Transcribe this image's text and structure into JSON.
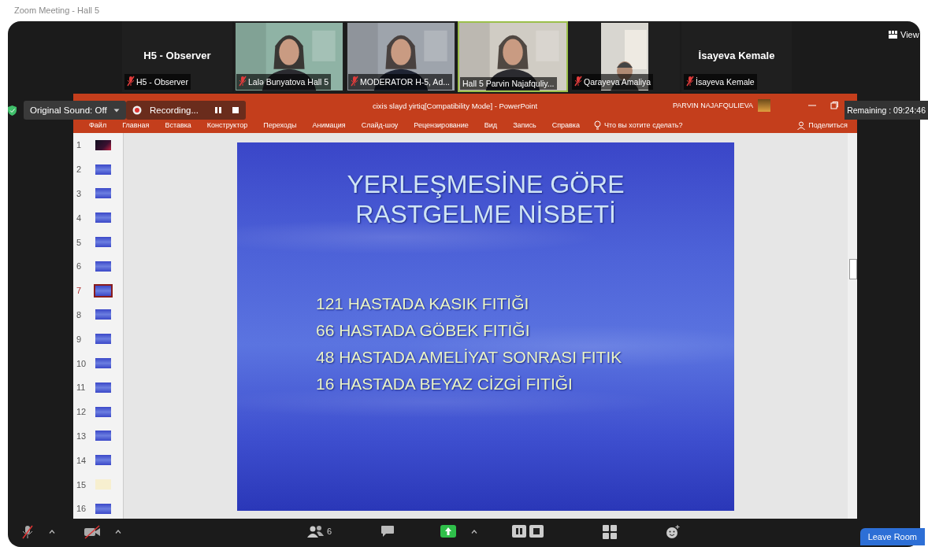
{
  "window": {
    "title": "Zoom Meeting - Hall 5"
  },
  "participants": [
    {
      "kind": "name",
      "name": "H5 - Observer",
      "label": "H5 - Observer",
      "muted": true,
      "speaking": false
    },
    {
      "kind": "video",
      "label": "Lalə Bunyatova Hall 5",
      "muted": true,
      "speaking": false
    },
    {
      "kind": "video",
      "label": "MODERATOR H-5, Ad...",
      "muted": true,
      "speaking": false
    },
    {
      "kind": "video",
      "label": "Hall 5  Parvin Najafquliy...",
      "muted": false,
      "speaking": true
    },
    {
      "kind": "small-video",
      "label": "Qarayeva Amaliya",
      "muted": true,
      "speaking": false
    },
    {
      "kind": "name",
      "name": "İsayeva Kemale",
      "label": "İsayeva Kemale",
      "muted": true,
      "speaking": false
    }
  ],
  "view_button": "View",
  "original_sound": "Original Sound: Off",
  "recording": "Recording...",
  "remaining": "Remaining : 09:24:46",
  "powerpoint": {
    "title": "cixis slayd yirtiq[Compatibility Mode]  -  PowerPoint",
    "user": "PARVIN NAJAFQULIEVA",
    "tabs": [
      "Файл",
      "Главная",
      "Вставка",
      "Конструктор",
      "Переходы",
      "Анимация",
      "Слайд-шоу",
      "Рецензирование",
      "Вид",
      "Запись",
      "Справка"
    ],
    "tell_me": "Что вы хотите сделать?",
    "share": "Поделиться",
    "thumbnails": [
      {
        "number": "1",
        "kind": "dark",
        "selected": false
      },
      {
        "number": "2",
        "kind": "blue",
        "selected": false
      },
      {
        "number": "3",
        "kind": "blue",
        "selected": false
      },
      {
        "number": "4",
        "kind": "blue",
        "selected": false
      },
      {
        "number": "5",
        "kind": "blue",
        "selected": false
      },
      {
        "number": "6",
        "kind": "blue",
        "selected": false
      },
      {
        "number": "7",
        "kind": "blue",
        "selected": true
      },
      {
        "number": "8",
        "kind": "blue",
        "selected": false
      },
      {
        "number": "9",
        "kind": "blue",
        "selected": false
      },
      {
        "number": "10",
        "kind": "blue",
        "selected": false
      },
      {
        "number": "11",
        "kind": "blue",
        "selected": false
      },
      {
        "number": "12",
        "kind": "blue",
        "selected": false
      },
      {
        "number": "13",
        "kind": "blue",
        "selected": false
      },
      {
        "number": "14",
        "kind": "blue",
        "selected": false
      },
      {
        "number": "15",
        "kind": "light",
        "selected": false
      },
      {
        "number": "16",
        "kind": "blue",
        "selected": false
      }
    ],
    "slide": {
      "title": [
        "YERLEŞMESİNE GÖRE",
        "RASTGELME NİSBETİ"
      ],
      "lines": [
        "121 HASTADA KASIK FITIĞI",
        "66 HASTADA GÖBEK FITIĞI",
        "48 HASTADA AMELİYAT SONRASI FITIK",
        "16 HASTADA BEYAZ CİZGİ FITIĞI"
      ]
    }
  },
  "toolbar": {
    "mic_muted": true,
    "video_off": true,
    "participant_count": "6",
    "leave": "Leave Room"
  }
}
